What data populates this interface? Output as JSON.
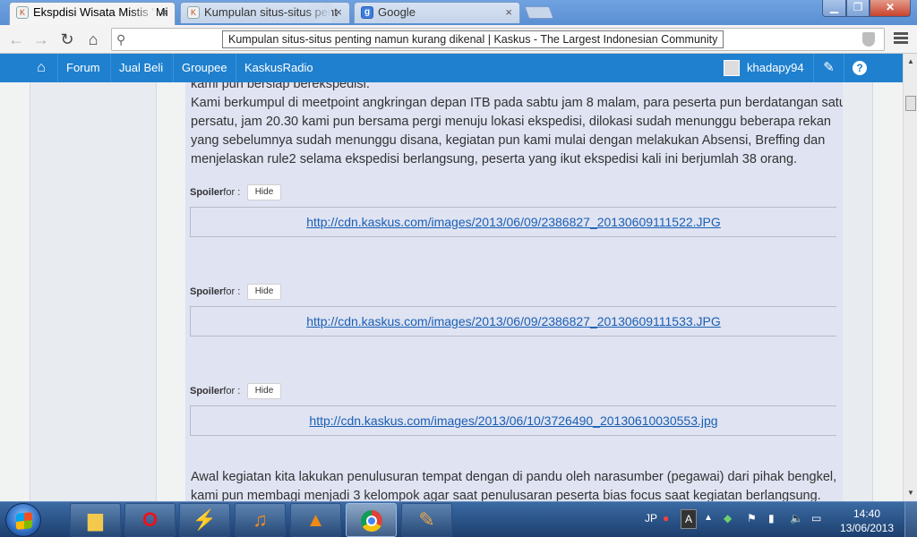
{
  "browser": {
    "tabs": [
      {
        "title": "Ekspdisi Wisata Mistis \"Mi",
        "favicon": "kaskus-favicon",
        "active": true
      },
      {
        "title": "Kumpulan situs-situs pent",
        "favicon": "kaskus-favicon",
        "active": false
      },
      {
        "title": "Google",
        "favicon": "google-favicon",
        "active": false
      }
    ],
    "tab_close": "×",
    "address": "Kumpulan situs-situs penting namun kurang dikenal | Kaskus - The Largest Indonesian Community"
  },
  "site_nav": {
    "items": [
      "Forum",
      "Jual Beli",
      "Groupee",
      "KaskusRadio"
    ],
    "username": "khadapy94",
    "help": "?"
  },
  "post": {
    "paragraph_top": [
      "kami pun bersiap berekspedisi.",
      "Kami berkumpul di meetpoint angkringan depan ITB pada sabtu jam 8 malam, para peserta pun berdatangan satu",
      "persatu, jam 20.30 kami pun bersama pergi menuju lokasi ekspedisi, dilokasi sudah menunggu beberapa rekan",
      "yang sebelumnya sudah menunggu disana, kegiatan pun kami mulai dengan melakukan Absensi, Breffing dan",
      "menjelaskan rule2 selama ekspedisi berlangsung, peserta yang ikut ekspedisi kali ini berjumlah 38 orang."
    ],
    "spoilers": [
      {
        "label": "Spoiler",
        "for": "for :",
        "button": "Hide",
        "link": "http://cdn.kaskus.com/images/2013/06/09/2386827_20130609111522.JPG"
      },
      {
        "label": "Spoiler",
        "for": "for :",
        "button": "Hide",
        "link": "http://cdn.kaskus.com/images/2013/06/09/2386827_20130609111533.JPG"
      },
      {
        "label": "Spoiler",
        "for": "for :",
        "button": "Hide",
        "link": "http://cdn.kaskus.com/images/2013/06/10/3726490_20130610030553.jpg"
      }
    ],
    "paragraph_bottom": [
      "Awal kegiatan kita lakukan penulusuran tempat dengan di pandu oleh narasumber (pegawai) dari pihak bengkel,",
      "kami pun membagi menjadi 3 kelompok agar saat penulusaran peserta bias focus saat kegiatan berlangsung."
    ]
  },
  "taskbar": {
    "language": "JP",
    "ime": "A",
    "time": "14:40",
    "date": "13/06/2013"
  }
}
